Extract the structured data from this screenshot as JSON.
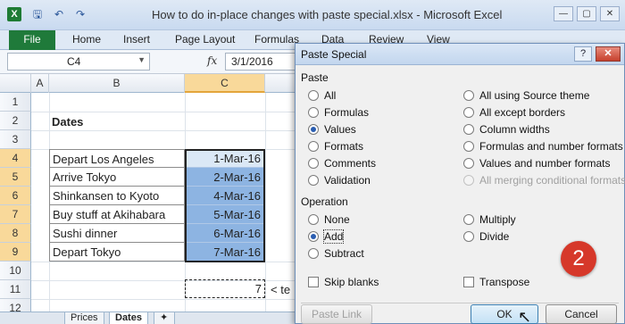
{
  "window": {
    "app_icon": "X",
    "title": "How to do in-place changes with paste special.xlsx - Microsoft Excel",
    "qat": [
      "save-icon",
      "undo-icon",
      "redo-icon"
    ],
    "min": "—",
    "max": "▢",
    "close": "✕"
  },
  "ribbon": {
    "file": "File",
    "tabs": [
      "Home",
      "Insert",
      "Page Layout",
      "Formulas",
      "Data",
      "Review",
      "View"
    ]
  },
  "formula_bar": {
    "name_box": "C4",
    "fx": "fx",
    "content": "3/1/2016"
  },
  "sheet": {
    "columns": [
      "A",
      "B",
      "C"
    ],
    "rows": [
      "1",
      "2",
      "3",
      "4",
      "5",
      "6",
      "7",
      "8",
      "9",
      "10",
      "11",
      "12"
    ],
    "header_cell": "Dates",
    "items": [
      {
        "label": "Depart Los Angeles",
        "date": "1-Mar-16"
      },
      {
        "label": "Arrive Tokyo",
        "date": "2-Mar-16"
      },
      {
        "label": "Shinkansen to Kyoto",
        "date": "4-Mar-16"
      },
      {
        "label": "Buy stuff at Akihabara",
        "date": "5-Mar-16"
      },
      {
        "label": "Sushi dinner",
        "date": "6-Mar-16"
      },
      {
        "label": "Depart Tokyo",
        "date": "7-Mar-16"
      }
    ],
    "copied_value": "7",
    "note": "< te",
    "tabs": [
      "Prices",
      "Dates"
    ]
  },
  "dialog": {
    "title": "Paste Special",
    "help": "?",
    "close": "✕",
    "paste_label": "Paste",
    "paste_left": [
      "All",
      "Formulas",
      "Values",
      "Formats",
      "Comments",
      "Validation"
    ],
    "paste_right": [
      "All using Source theme",
      "All except borders",
      "Column widths",
      "Formulas and number formats",
      "Values and number formats",
      "All merging conditional formats"
    ],
    "operation_label": "Operation",
    "op_left": [
      "None",
      "Add",
      "Subtract"
    ],
    "op_right": [
      "Multiply",
      "Divide"
    ],
    "skip_blanks": "Skip blanks",
    "transpose": "Transpose",
    "paste_link": "Paste Link",
    "ok": "OK",
    "cancel": "Cancel"
  },
  "annotation": {
    "step": "2",
    "color": "#d6382a"
  }
}
